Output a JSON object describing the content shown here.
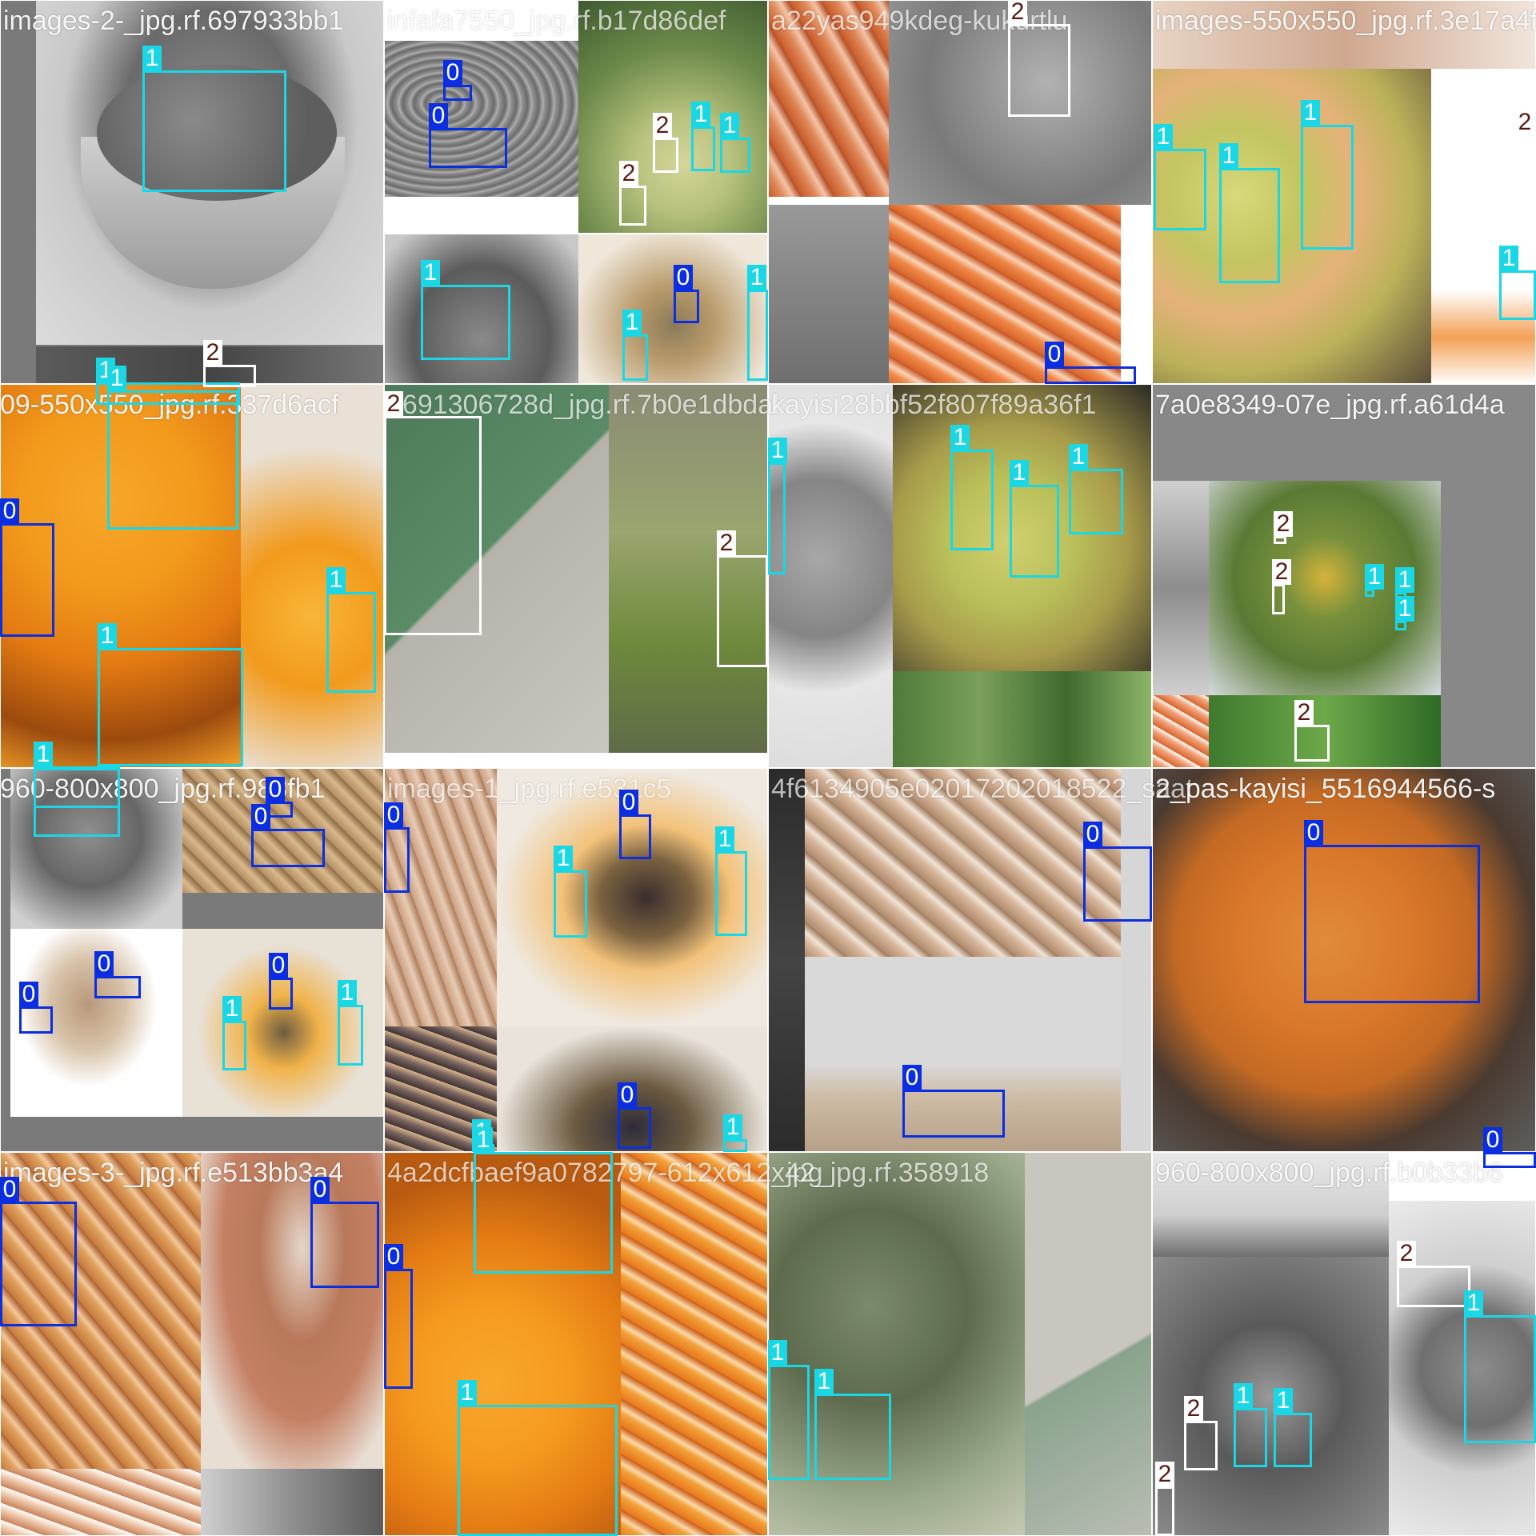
{
  "grid": {
    "rows": 4,
    "cols": 4
  },
  "classes": [
    {
      "id": "0",
      "color": "#0a2ee0",
      "text_color": "#ffffff",
      "fill": "#0a2ee0"
    },
    {
      "id": "1",
      "color": "#1ad7e6",
      "text_color": "#ffffff",
      "fill": "#1ad7e6"
    },
    {
      "id": "2",
      "color": "#ffffff",
      "text_color": "#5a1a10",
      "fill": "#ffffff"
    }
  ],
  "tiles": [
    {
      "title": "images-2-_jpg.rf.697933bb1",
      "overlap_title": "infafa7550_jpg.rf.b17d86def",
      "boxes": [
        {
          "class": "1",
          "label": "1"
        },
        {
          "class": "0",
          "label": "0"
        },
        {
          "class": "0",
          "label": "0"
        },
        {
          "class": "1",
          "label": "1"
        },
        {
          "class": "2",
          "label": "2"
        },
        {
          "class": "2",
          "label": "2"
        },
        {
          "class": "1",
          "label": "1"
        },
        {
          "class": "1",
          "label": "1"
        },
        {
          "class": "0",
          "label": "0"
        },
        {
          "class": "1",
          "label": "1"
        },
        {
          "class": "1",
          "label": "1"
        },
        {
          "class": "1",
          "label": "1"
        },
        {
          "class": "2",
          "label": "2"
        }
      ]
    },
    {
      "title": "fafa7550_jpg.rf.b17d86def",
      "overlap_title": "",
      "boxes": []
    },
    {
      "title": "a22yas949kdeg-kukurtlu",
      "overlap_title": "2",
      "boxes": [
        {
          "class": "2",
          "label": "2"
        },
        {
          "class": "0",
          "label": "0"
        }
      ]
    },
    {
      "title": "images-550x550_jpg.rf.3e17a4f4fc",
      "overlap_title": "",
      "boxes": [
        {
          "class": "1",
          "label": "1"
        },
        {
          "class": "1",
          "label": "1"
        },
        {
          "class": "1",
          "label": "1"
        },
        {
          "class": "1",
          "label": "1"
        },
        {
          "class": "2",
          "label": "2"
        }
      ]
    },
    {
      "title": "09-550x550_jpg.rf.337d6acf",
      "overlap_title": "",
      "boxes": [
        {
          "class": "1",
          "label": "1"
        },
        {
          "class": "1",
          "label": "1"
        },
        {
          "class": "0",
          "label": "0"
        },
        {
          "class": "1",
          "label": "1"
        },
        {
          "class": "1",
          "label": "1"
        }
      ]
    },
    {
      "title": "2691306728d_jpg.rf.7b0e1dbdal",
      "overlap_title": "",
      "boxes": [
        {
          "class": "2",
          "label": "2"
        },
        {
          "class": "2",
          "label": "2"
        }
      ]
    },
    {
      "title": "kayisi28bbf52f807f89a36f1",
      "overlap_title": "",
      "boxes": [
        {
          "class": "1",
          "label": "1"
        },
        {
          "class": "1",
          "label": "1"
        },
        {
          "class": "1",
          "label": "1"
        },
        {
          "class": "1",
          "label": "1"
        }
      ]
    },
    {
      "title": "7a0e8349-07e_jpg.rf.a61d4a",
      "overlap_title": "",
      "boxes": [
        {
          "class": "2",
          "label": "2"
        },
        {
          "class": "2",
          "label": "2"
        },
        {
          "class": "1",
          "label": "1"
        },
        {
          "class": "1",
          "label": "1"
        },
        {
          "class": "1",
          "label": "1"
        },
        {
          "class": "2",
          "label": "2"
        }
      ]
    },
    {
      "title": "960-800x800_jpg.rf.983fb1",
      "overlap_title": "",
      "boxes": [
        {
          "class": "1",
          "label": "1"
        },
        {
          "class": "0",
          "label": "0"
        },
        {
          "class": "0",
          "label": "0"
        },
        {
          "class": "0",
          "label": "0"
        },
        {
          "class": "0",
          "label": "0"
        },
        {
          "class": "0",
          "label": "0"
        },
        {
          "class": "1",
          "label": "1"
        },
        {
          "class": "1",
          "label": "1"
        }
      ]
    },
    {
      "title": "images-1_jpg.rf.e531c5",
      "overlap_title": "",
      "boxes": [
        {
          "class": "0",
          "label": "0"
        },
        {
          "class": "0",
          "label": "0"
        },
        {
          "class": "1",
          "label": "1"
        },
        {
          "class": "1",
          "label": "1"
        },
        {
          "class": "0",
          "label": "0"
        },
        {
          "class": "1",
          "label": "1"
        },
        {
          "class": "1",
          "label": "1"
        }
      ]
    },
    {
      "title": "4f6134905e02017202018522_saat",
      "overlap_title": "",
      "boxes": [
        {
          "class": "0",
          "label": "0"
        },
        {
          "class": "0",
          "label": "0"
        }
      ]
    },
    {
      "title": "2_pas-kayisi_5516944566-s",
      "overlap_title": "",
      "boxes": [
        {
          "class": "0",
          "label": "0"
        },
        {
          "class": "0",
          "label": "0"
        }
      ]
    },
    {
      "title": "images-3-_jpg.rf.e513bb3a4",
      "overlap_title": "",
      "boxes": [
        {
          "class": "0",
          "label": "0"
        },
        {
          "class": "0",
          "label": "0"
        }
      ]
    },
    {
      "title": "4a2dcfbaef9a0782797-612x612_jpg",
      "overlap_title": "",
      "boxes": [
        {
          "class": "1",
          "label": "1"
        },
        {
          "class": "0",
          "label": "0"
        },
        {
          "class": "1",
          "label": "1"
        }
      ]
    },
    {
      "title": "x42_jpg.rf.358918",
      "overlap_title": "",
      "boxes": [
        {
          "class": "1",
          "label": "1"
        },
        {
          "class": "1",
          "label": "1"
        }
      ]
    },
    {
      "title": "960-800x800_jpg.rf.b0b33b6",
      "overlap_title": "",
      "boxes": [
        {
          "class": "2",
          "label": "2"
        },
        {
          "class": "1",
          "label": "1"
        },
        {
          "class": "2",
          "label": "2"
        },
        {
          "class": "1",
          "label": "1"
        },
        {
          "class": "1",
          "label": "1"
        },
        {
          "class": "2",
          "label": "2"
        }
      ]
    }
  ]
}
